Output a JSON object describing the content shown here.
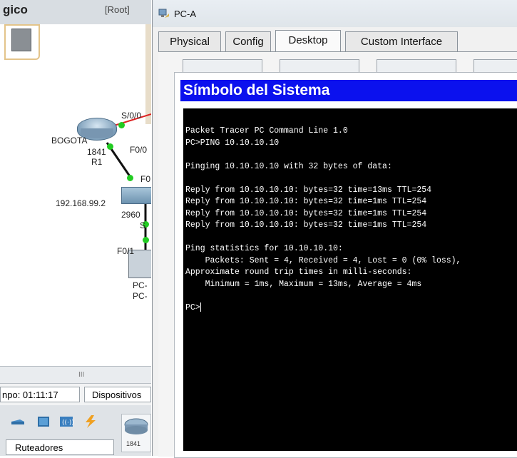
{
  "workspace": {
    "title": "gico",
    "mode": "[Root]",
    "labels": {
      "serial_port": "S/0/0",
      "router_name": "BOGOTA",
      "router_model": "1841",
      "router_id": "R1",
      "router_port_f0": "F0/0",
      "switch_port_f0": "F0",
      "ip": "192.168.99.2",
      "switch_model": "2960",
      "switch_suffix": "S",
      "pc_port": "F0/1",
      "pc_name_1": "PC-",
      "pc_name_2": "PC-"
    },
    "scrollbar_glyph": "III",
    "time_label": "npo: 01:11:17",
    "devices_tab": "Dispositivos",
    "device_category": "Ruteadores",
    "device_tile_label": "1841"
  },
  "window": {
    "title": "PC-A",
    "tabs": [
      {
        "label": "Physical"
      },
      {
        "label": "Config"
      },
      {
        "label": "Desktop",
        "active": true
      },
      {
        "label": "Custom Interface"
      }
    ],
    "console": {
      "title": "Símbolo del Sistema",
      "lines": [
        "Packet Tracer PC Command Line 1.0",
        "PC>PING 10.10.10.10",
        "",
        "Pinging 10.10.10.10 with 32 bytes of data:",
        "",
        "Reply from 10.10.10.10: bytes=32 time=13ms TTL=254",
        "Reply from 10.10.10.10: bytes=32 time=1ms TTL=254",
        "Reply from 10.10.10.10: bytes=32 time=1ms TTL=254",
        "Reply from 10.10.10.10: bytes=32 time=1ms TTL=254",
        "",
        "Ping statistics for 10.10.10.10:",
        "    Packets: Sent = 4, Received = 4, Lost = 0 (0% loss),",
        "Approximate round trip times in milli-seconds:",
        "    Minimum = 1ms, Maximum = 13ms, Average = 4ms",
        ""
      ],
      "prompt": "PC>"
    }
  },
  "colors": {
    "console_header": "#0b11ee",
    "terminal_bg": "#000000",
    "terminal_text": "#ffffff",
    "link_up": "#22cc22",
    "serial_link": "#dd2222"
  }
}
